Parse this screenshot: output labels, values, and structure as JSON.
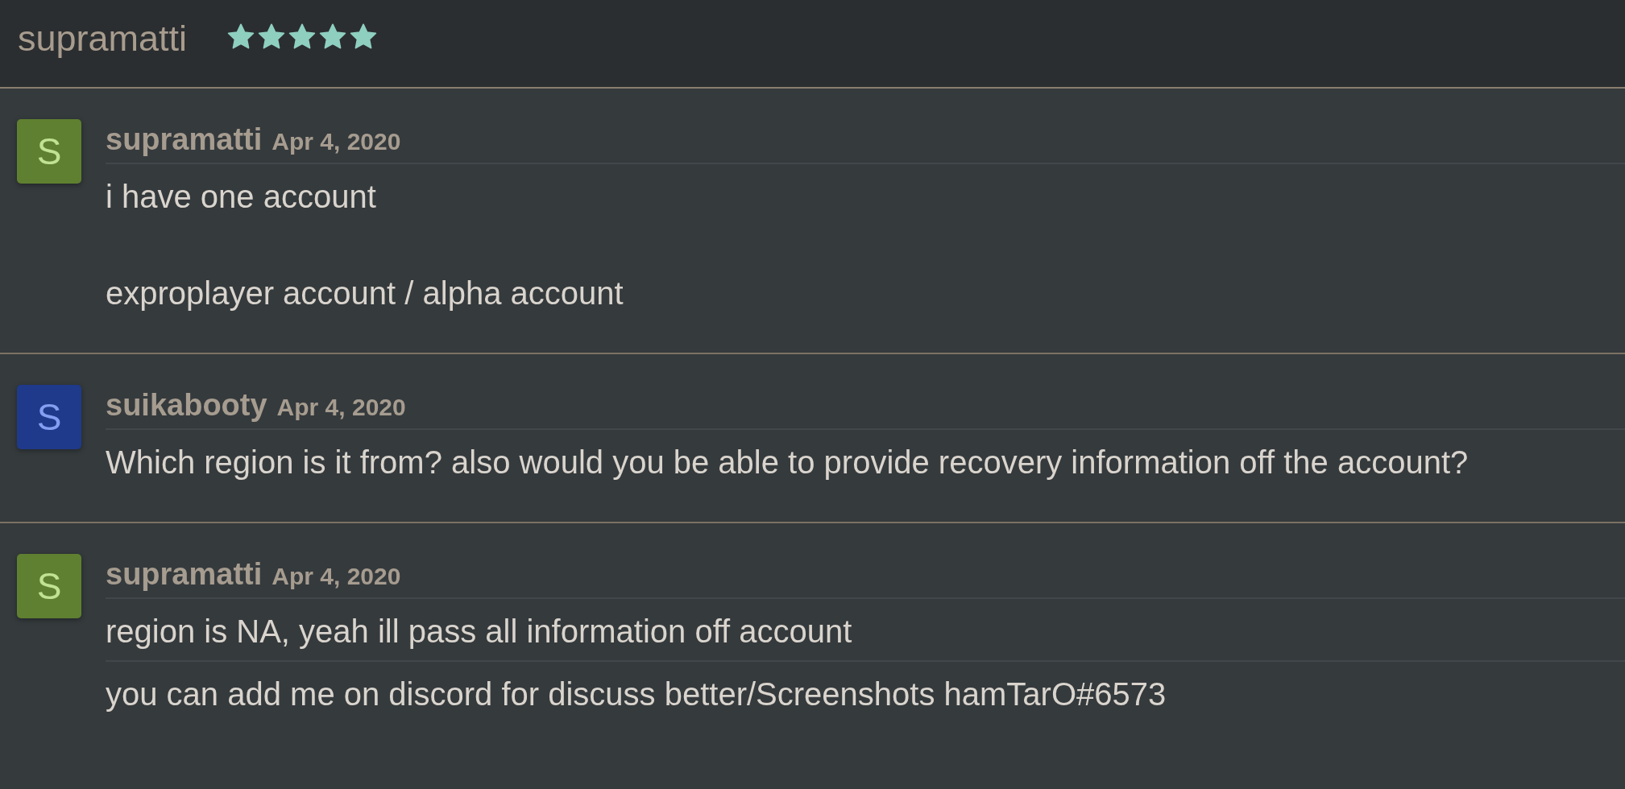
{
  "header": {
    "title": "supramatti",
    "stars": 5
  },
  "messages": [
    {
      "author": "supramatti",
      "date": "Apr 4, 2020",
      "avatar": {
        "initial": "S",
        "color": "#5f8030"
      },
      "posts": [
        "i have one account\n\nexproplayer account / alpha account"
      ]
    },
    {
      "author": "suikabooty",
      "date": "Apr 4, 2020",
      "avatar": {
        "initial": "S",
        "color": "#1f3a8a"
      },
      "posts": [
        "Which region is it from? also would you be able to provide recovery information off the account?"
      ]
    },
    {
      "author": "supramatti",
      "date": "Apr 4, 2020",
      "avatar": {
        "initial": "S",
        "color": "#5f8030"
      },
      "posts": [
        "region is NA, yeah ill pass all information off account",
        "you can add me on discord for discuss better/Screenshots hamTarO#6573"
      ]
    }
  ]
}
